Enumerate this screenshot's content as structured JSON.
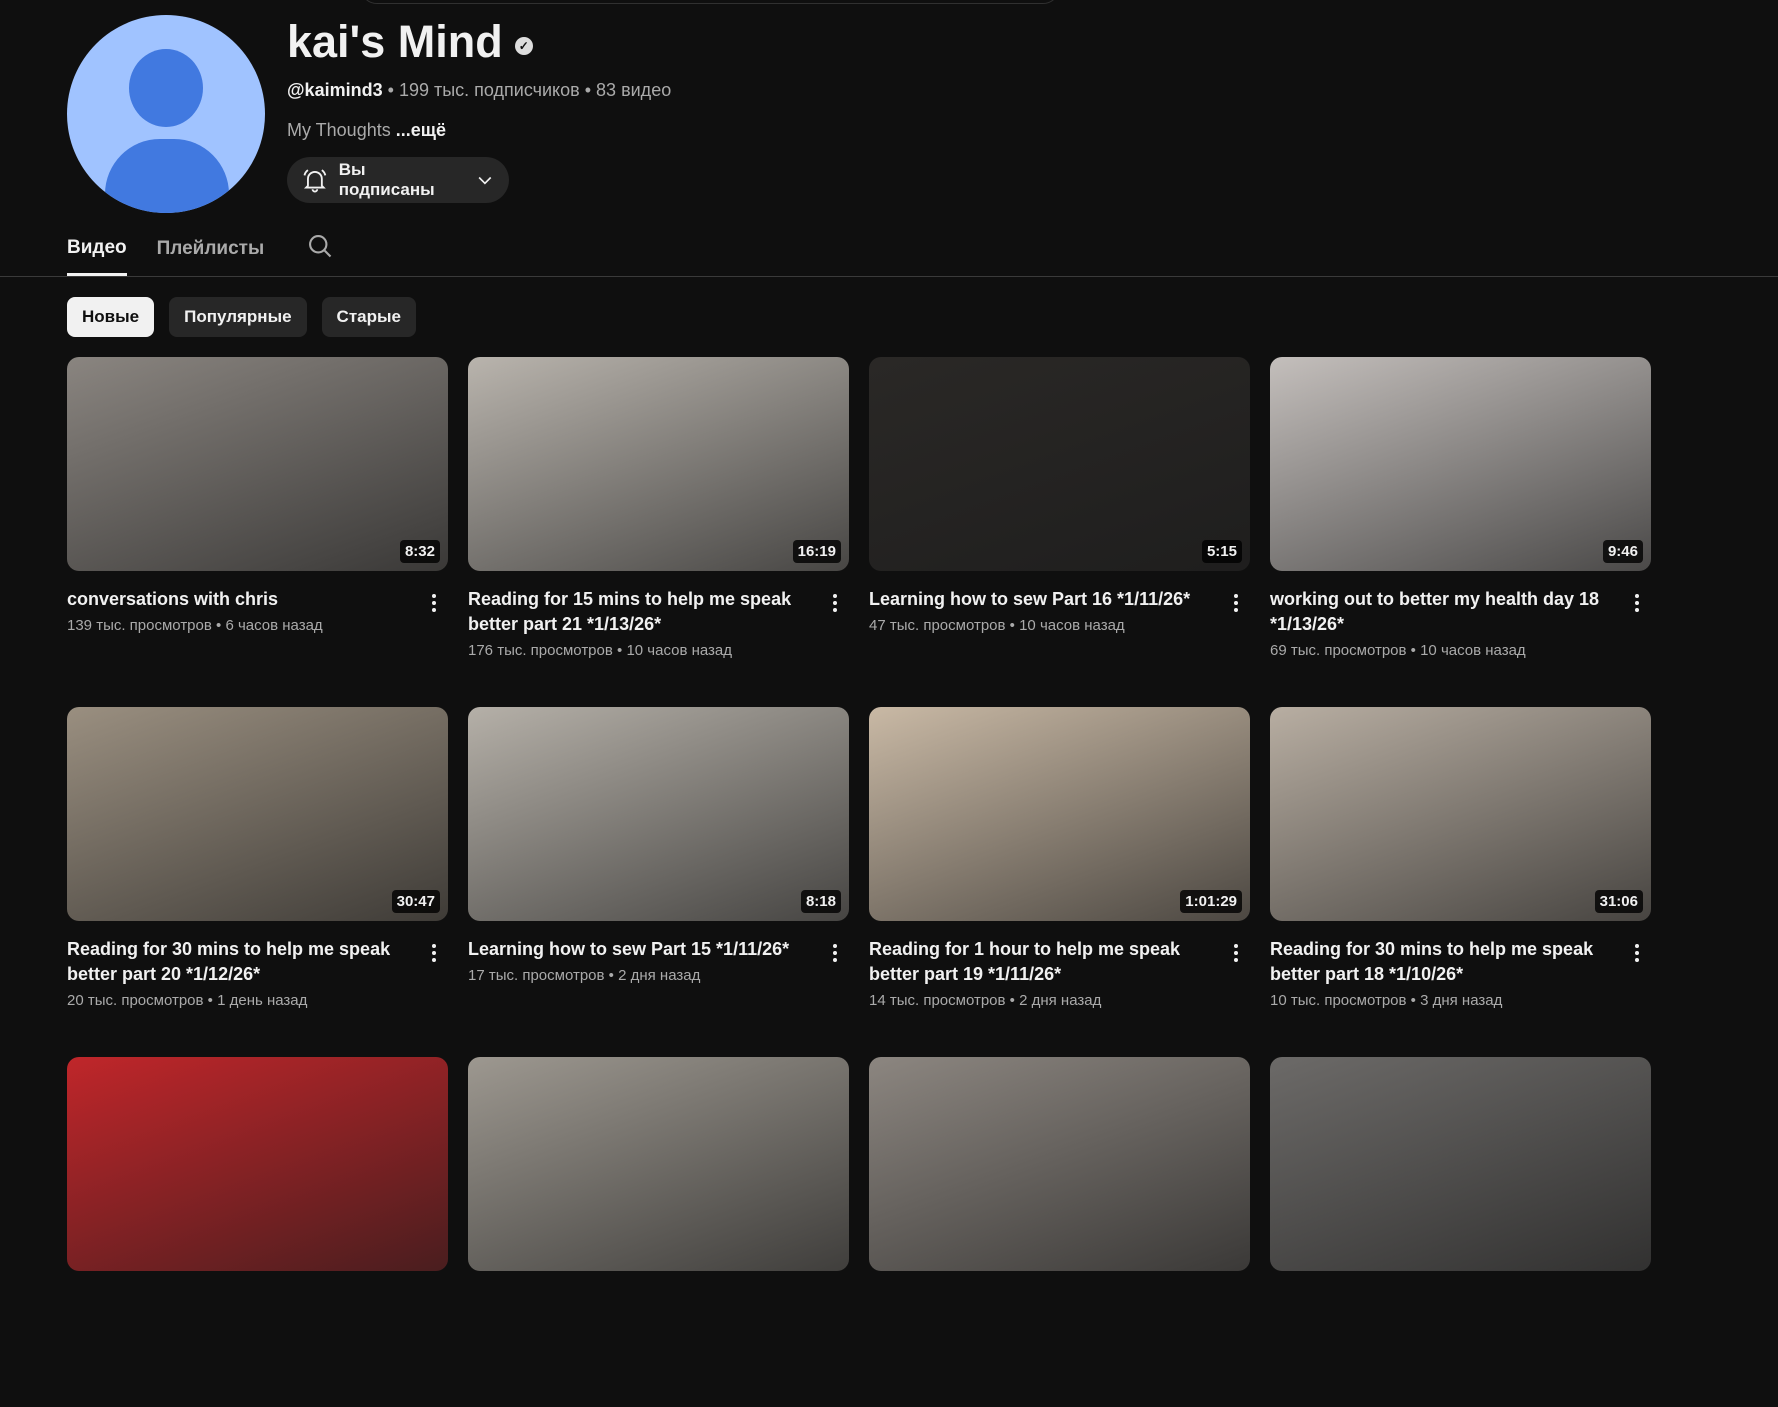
{
  "channel": {
    "name": "kai's Mind",
    "handle": "@kaimind3",
    "subscribers": "199 тыс. подписчиков",
    "video_count": "83 видео",
    "separator": "•",
    "description": "My Thoughts",
    "more": "...ещё",
    "subscribe_label": "Вы подписаны"
  },
  "tabs": [
    {
      "label": "Видео",
      "active": true
    },
    {
      "label": "Плейлисты",
      "active": false
    }
  ],
  "chips": [
    {
      "label": "Новые",
      "active": true
    },
    {
      "label": "Популярные"
    },
    {
      "label": "Старые"
    }
  ],
  "videos": [
    {
      "title": "conversations with chris",
      "views": "139 тыс. просмотров",
      "age": "6 часов назад",
      "duration": "8:32",
      "color": "#8a8580"
    },
    {
      "title": "Reading for 15 mins to help me speak better part 21 *1/13/26*",
      "views": "176 тыс. просмотров",
      "age": "10 часов назад",
      "duration": "16:19",
      "color": "#b9b4ad"
    },
    {
      "title": "Learning how to sew Part 16 *1/11/26*",
      "views": "47 тыс. просмотров",
      "age": "10 часов назад",
      "duration": "5:15",
      "color": "#2a2826"
    },
    {
      "title": "working out to better my health day 18 *1/13/26*",
      "views": "69 тыс. просмотров",
      "age": "10 часов назад",
      "duration": "9:46",
      "color": "#c4bfbc"
    },
    {
      "title": "Reading for 30 mins to help me speak better part 20 *1/12/26*",
      "views": "20 тыс. просмотров",
      "age": "1 день назад",
      "duration": "30:47",
      "color": "#9a8f80"
    },
    {
      "title": "Learning how to sew Part 15 *1/11/26*",
      "views": "17 тыс. просмотров",
      "age": "2 дня назад",
      "duration": "8:18",
      "color": "#b5b0a8"
    },
    {
      "title": "Reading for 1 hour to help me speak better part 19 *1/11/26*",
      "views": "14 тыс. просмотров",
      "age": "2 дня назад",
      "duration": "1:01:29",
      "color": "#c9b9a5"
    },
    {
      "title": "Reading for 30 mins to help me speak better part 18 *1/10/26*",
      "views": "10 тыс. просмотров",
      "age": "3 дня назад",
      "duration": "31:06",
      "color": "#b8aea2"
    },
    {
      "color": "#c0262a"
    },
    {
      "color": "#9d9890"
    },
    {
      "color": "#8c8680"
    },
    {
      "color": "#6c6a68"
    }
  ]
}
